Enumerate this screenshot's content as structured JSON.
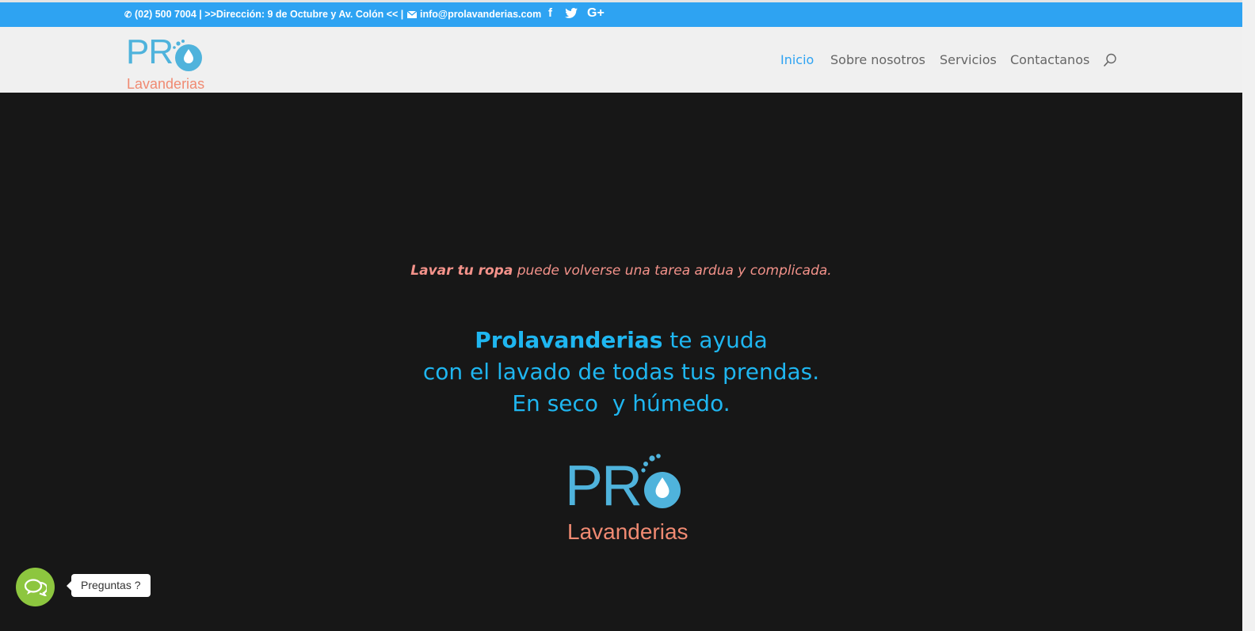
{
  "topbar": {
    "phone_address": "(02) 500 7004 | >>Dirección: 9 de Octubre y Av. Colón << |",
    "email": "info@prolavanderias.com",
    "social": [
      "facebook-icon",
      "twitter-icon",
      "google-plus-icon"
    ]
  },
  "header": {
    "logo_pro": "PR",
    "logo_sub": "Lavanderias",
    "nav": [
      "Inicio",
      "Sobre nosotros",
      "Servicios",
      "Contactanos"
    ],
    "active_nav": "Inicio"
  },
  "hero": {
    "line1_bold": "Lavar tu ropa",
    "line1_rest": " puede volverse una tarea ardua y complicada.",
    "main_bold": "Prolavanderias",
    "main_rest": " te ayuda",
    "main_line2": "con el lavado de todas tus prendas.",
    "main_line3": "En seco  y húmedo.",
    "logo_pro": "PR",
    "logo_sub": "Lavanderias"
  },
  "chat": {
    "label": "Preguntas ?"
  },
  "colors": {
    "topbar": "#2ea3f2",
    "header_bg": "#f0f0f0",
    "hero_bg": "#171717",
    "accent_blue": "#1fb6f0",
    "salmon": "#f3928a",
    "chat_green": "#8dc63f"
  }
}
